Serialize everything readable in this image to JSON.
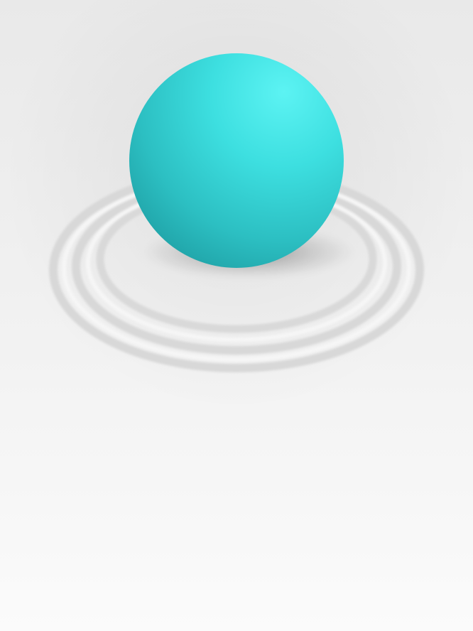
{
  "scene": {
    "subject": "teal-sphere-on-rings",
    "colors": {
      "background_top": "#e9e9e9",
      "background_bottom": "#fbfbfb",
      "sphere_highlight": "#5cf3f3",
      "sphere_mid": "#33d4d6",
      "sphere_shadow": "#1e9ea3",
      "ring_groove": "#d6d6d6",
      "ring_highlight": "#f7f7f7"
    }
  }
}
